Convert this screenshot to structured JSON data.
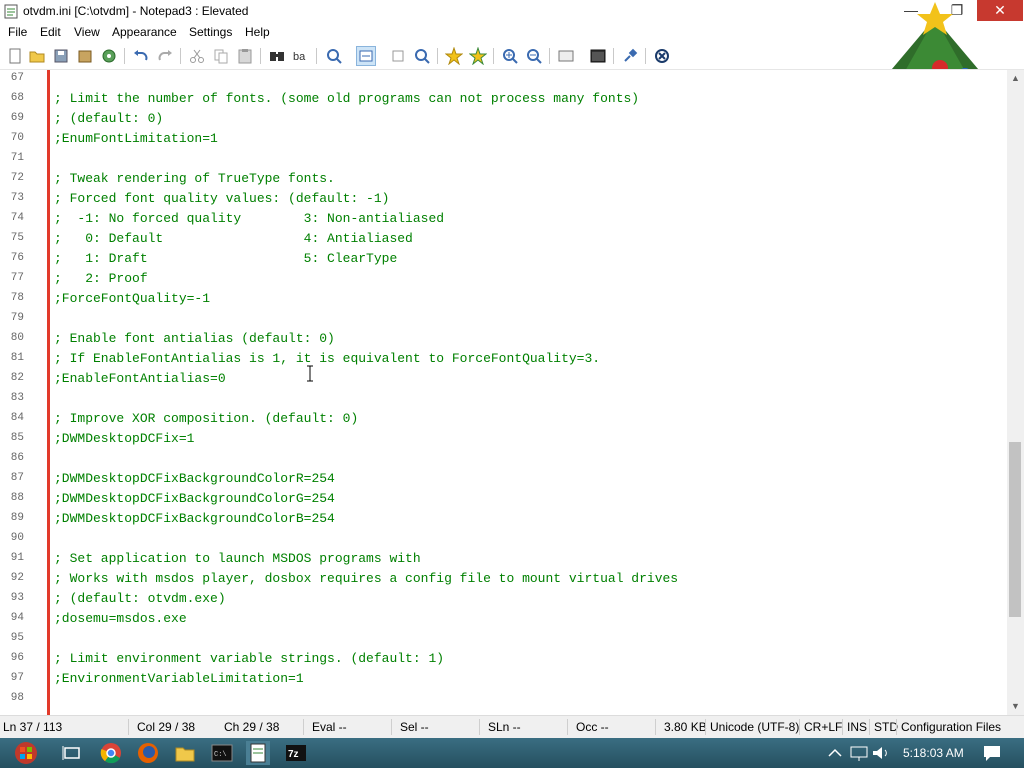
{
  "window": {
    "title": "otvdm.ini [C:\\otvdm] - Notepad3 : Elevated",
    "controls": {
      "minimize": "—",
      "maximize": "❐",
      "close": "✕"
    }
  },
  "menu": [
    "File",
    "Edit",
    "View",
    "Appearance",
    "Settings",
    "Help"
  ],
  "toolbar": {
    "icons": [
      "new-file-icon",
      "open-folder-icon",
      "save-icon",
      "save-as-icon",
      "browse-icon",
      "undo-icon",
      "redo-icon",
      "cut-icon",
      "copy-icon",
      "paste-icon",
      "find-icon",
      "replace-icon",
      "goto-icon",
      "word-wrap-icon",
      "zoom-icon",
      "favorites-icon",
      "add-favorite-icon",
      "zoom-in-icon",
      "zoom-out-icon",
      "scheme-icon",
      "customize-icon",
      "pin-icon",
      "exit-icon"
    ]
  },
  "editor": {
    "lines": [
      {
        "n": "67",
        "t": ""
      },
      {
        "n": "68",
        "t": "; Limit the number of fonts. (some old programs can not process many fonts)"
      },
      {
        "n": "69",
        "t": "; (default: 0)"
      },
      {
        "n": "70",
        "t": ";EnumFontLimitation=1"
      },
      {
        "n": "71",
        "t": ""
      },
      {
        "n": "72",
        "t": "; Tweak rendering of TrueType fonts."
      },
      {
        "n": "73",
        "t": "; Forced font quality values: (default: -1)"
      },
      {
        "n": "74",
        "t": ";  -1: No forced quality        3: Non-antialiased"
      },
      {
        "n": "75",
        "t": ";   0: Default                  4: Antialiased"
      },
      {
        "n": "76",
        "t": ";   1: Draft                    5: ClearType"
      },
      {
        "n": "77",
        "t": ";   2: Proof"
      },
      {
        "n": "78",
        "t": ";ForceFontQuality=-1"
      },
      {
        "n": "79",
        "t": ""
      },
      {
        "n": "80",
        "t": "; Enable font antialias (default: 0)"
      },
      {
        "n": "81",
        "t": "; If EnableFontAntialias is 1, it is equivalent to ForceFontQuality=3."
      },
      {
        "n": "82",
        "t": ";EnableFontAntialias=0"
      },
      {
        "n": "83",
        "t": ""
      },
      {
        "n": "84",
        "t": "; Improve XOR composition. (default: 0)"
      },
      {
        "n": "85",
        "t": ";DWMDesktopDCFix=1"
      },
      {
        "n": "86",
        "t": ""
      },
      {
        "n": "87",
        "t": ";DWMDesktopDCFixBackgroundColorR=254"
      },
      {
        "n": "88",
        "t": ";DWMDesktopDCFixBackgroundColorG=254"
      },
      {
        "n": "89",
        "t": ";DWMDesktopDCFixBackgroundColorB=254"
      },
      {
        "n": "90",
        "t": ""
      },
      {
        "n": "91",
        "t": "; Set application to launch MSDOS programs with"
      },
      {
        "n": "92",
        "t": "; Works with msdos player, dosbox requires a config file to mount virtual drives"
      },
      {
        "n": "93",
        "t": "; (default: otvdm.exe)"
      },
      {
        "n": "94",
        "t": ";dosemu=msdos.exe"
      },
      {
        "n": "95",
        "t": ""
      },
      {
        "n": "96",
        "t": "; Limit environment variable strings. (default: 1)"
      },
      {
        "n": "97",
        "t": ";EnvironmentVariableLimitation=1"
      },
      {
        "n": "98",
        "t": ""
      }
    ]
  },
  "status": {
    "ln": "Ln 37 / 113",
    "col": "Col 29 / 38",
    "ch": "Ch 29 / 38",
    "eval": "Eval --",
    "sel": "Sel --",
    "sln": "SLn --",
    "occ": "Occ --",
    "size": "3.80 KB",
    "encoding": "Unicode (UTF-8)",
    "eol": "CR+LF",
    "ins": "INS",
    "std": "STD",
    "lexer": "Configuration Files"
  },
  "taskbar": {
    "clock": "5:18:03 AM",
    "apps": [
      "start-orb-icon",
      "task-view-icon",
      "chrome-icon",
      "firefox-icon",
      "explorer-icon",
      "cmd-icon",
      "notepad3-icon",
      "7zip-icon"
    ],
    "tray": [
      "show-hidden-icon",
      "network-icon",
      "volume-icon",
      "notification-icon"
    ]
  },
  "colors": {
    "comment": "#008000",
    "change_bar": "#e23a2a",
    "close_button": "#c7392f"
  }
}
